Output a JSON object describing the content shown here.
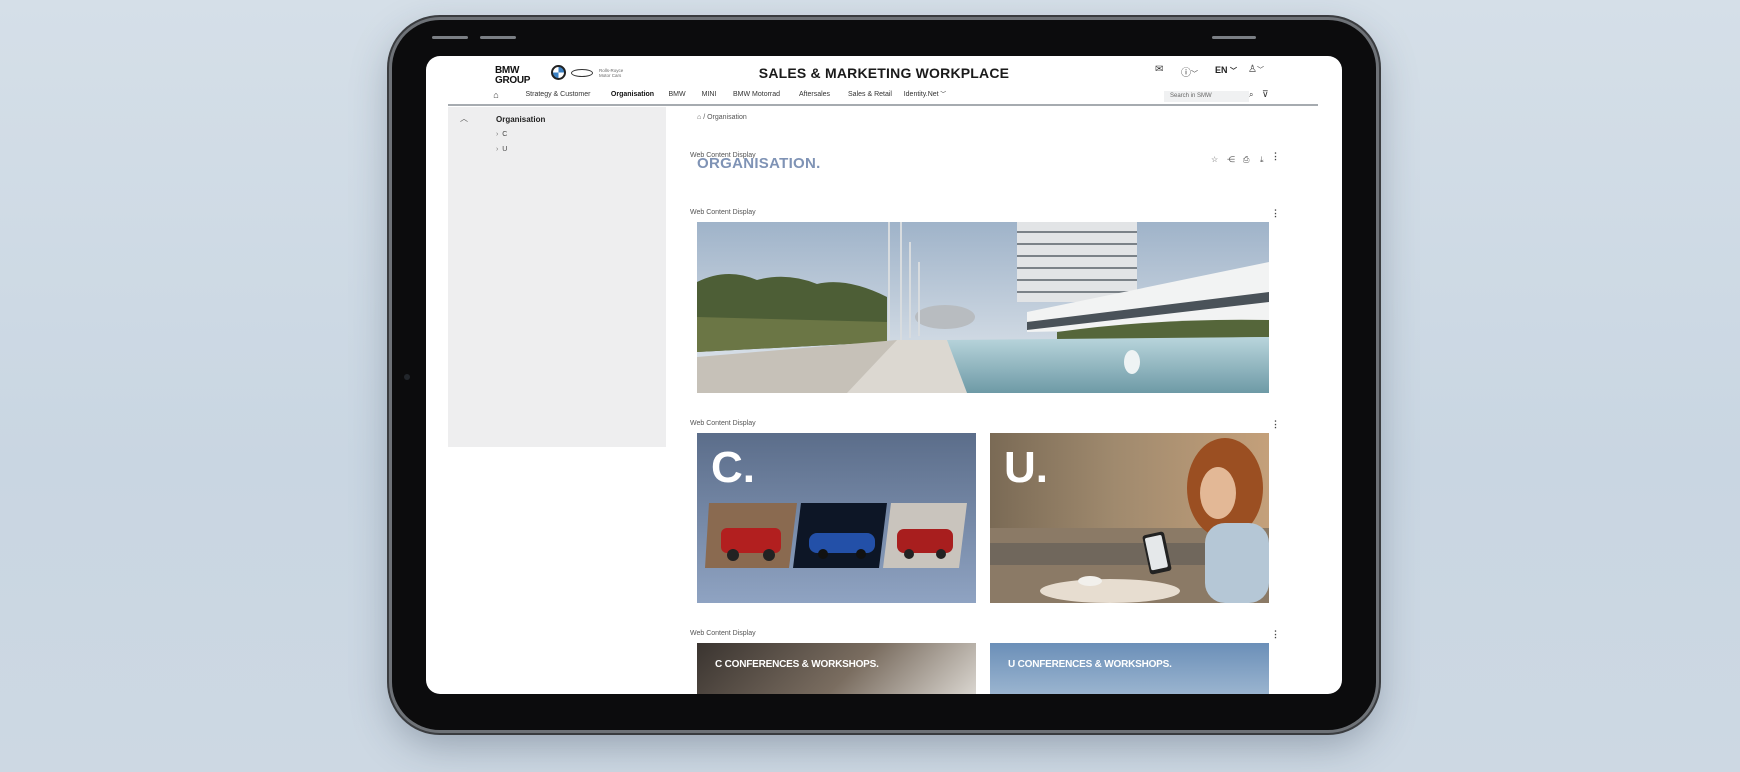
{
  "header": {
    "logo_text": "BMW GROUP",
    "rr_logo_text": "Rolls-Royce Motor Cars",
    "title": "SALES & MARKETING WORKPLACE",
    "language": "EN"
  },
  "nav": {
    "items": [
      {
        "label": ""
      },
      {
        "label": "Strategy & Customer"
      },
      {
        "label": "Organisation"
      },
      {
        "label": "BMW"
      },
      {
        "label": "MINI"
      },
      {
        "label": "BMW Motorrad"
      },
      {
        "label": "Aftersales"
      },
      {
        "label": "Sales & Retail"
      },
      {
        "label": "Identity.Net"
      }
    ],
    "active": "Organisation",
    "search_placeholder": "Search in SMW"
  },
  "sidebar": {
    "title": "Organisation",
    "items": [
      {
        "label": "C"
      },
      {
        "label": "U"
      }
    ]
  },
  "breadcrumb": {
    "current": "Organisation"
  },
  "content": {
    "portlet_label": "Web Content Display",
    "page_title": "ORGANISATION.",
    "cards": [
      {
        "letter": "C."
      },
      {
        "letter": "U."
      }
    ],
    "conferences": [
      {
        "label": "C CONFERENCES & WORKSHOPS."
      },
      {
        "label": "U CONFERENCES & WORKSHOPS."
      }
    ]
  },
  "colors": {
    "accent": "#7f93b5",
    "tablet_frame": "#0c0c0d",
    "background": "#cfdae5",
    "sidebar": "#eeeeef"
  }
}
